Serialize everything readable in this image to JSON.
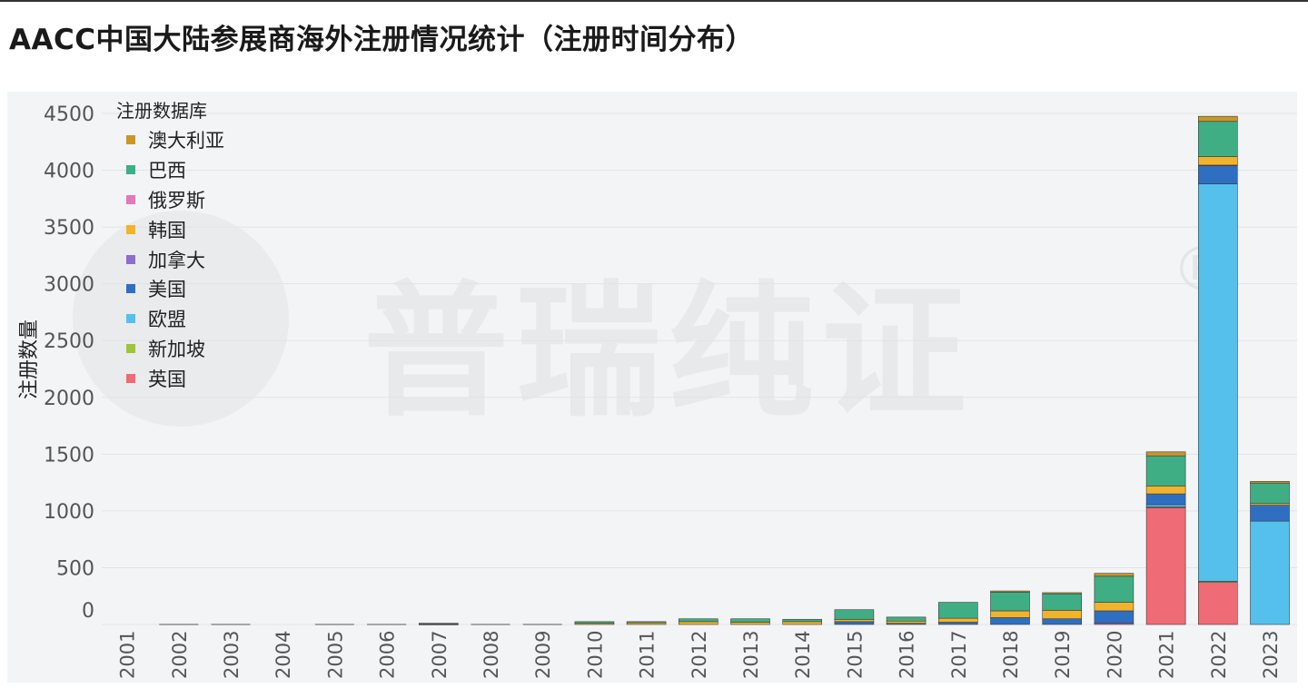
{
  "page": {
    "title": "AACC中国大陆参展商海外注册情况统计（注册时间分布）"
  },
  "watermark": {
    "text": "普瑞纯证",
    "reg_mark": "®"
  },
  "legend": {
    "title": "注册数据库",
    "items": [
      {
        "label": "澳大利亚",
        "color": "#c8962a"
      },
      {
        "label": "巴西",
        "color": "#3fae85"
      },
      {
        "label": "俄罗斯",
        "color": "#e279b8"
      },
      {
        "label": "韩国",
        "color": "#f2b32c"
      },
      {
        "label": "加拿大",
        "color": "#8e6ec8"
      },
      {
        "label": "美国",
        "color": "#2f6fc2"
      },
      {
        "label": "欧盟",
        "color": "#55c0ec"
      },
      {
        "label": "新加坡",
        "color": "#9ec43b"
      },
      {
        "label": "英国",
        "color": "#ef6b76"
      }
    ]
  },
  "chart_data": {
    "type": "bar",
    "stacked": true,
    "ylabel": "注册数量",
    "xlabel": "",
    "ylim": [
      0,
      4500
    ],
    "yticks": [
      0,
      500,
      1000,
      1500,
      2000,
      2500,
      3000,
      3500,
      4000,
      4500
    ],
    "grid": true,
    "legend_position": "top-left",
    "categories": [
      "2001",
      "2002",
      "2003",
      "2004",
      "2005",
      "2006",
      "2007",
      "2008",
      "2009",
      "2010",
      "2011",
      "2012",
      "2013",
      "2014",
      "2015",
      "2016",
      "2017",
      "2018",
      "2019",
      "2020",
      "2021",
      "2022",
      "2023"
    ],
    "series": [
      {
        "name": "英国",
        "color": "#ef6b76",
        "values": [
          0,
          0,
          0,
          0,
          0,
          0,
          0,
          0,
          0,
          0,
          0,
          0,
          0,
          0,
          0,
          0,
          0,
          0,
          0,
          10,
          1030,
          370,
          0
        ]
      },
      {
        "name": "新加坡",
        "color": "#9ec43b",
        "values": [
          0,
          0,
          0,
          0,
          0,
          0,
          0,
          0,
          0,
          0,
          0,
          0,
          0,
          0,
          0,
          0,
          0,
          0,
          0,
          0,
          5,
          10,
          0
        ]
      },
      {
        "name": "欧盟",
        "color": "#55c0ec",
        "values": [
          0,
          0,
          0,
          0,
          0,
          0,
          0,
          0,
          0,
          0,
          0,
          0,
          0,
          0,
          0,
          0,
          0,
          0,
          0,
          0,
          20,
          3500,
          910
        ]
      },
      {
        "name": "美国",
        "color": "#2f6fc2",
        "values": [
          0,
          0,
          0,
          0,
          0,
          0,
          3,
          0,
          0,
          0,
          0,
          0,
          0,
          0,
          25,
          10,
          20,
          60,
          50,
          110,
          95,
          160,
          140
        ]
      },
      {
        "name": "加拿大",
        "color": "#8e6ec8",
        "values": [
          0,
          0,
          0,
          0,
          0,
          0,
          0,
          0,
          0,
          0,
          0,
          0,
          0,
          0,
          0,
          0,
          0,
          0,
          0,
          0,
          0,
          5,
          0
        ]
      },
      {
        "name": "韩国",
        "color": "#f2b32c",
        "values": [
          0,
          0,
          0,
          0,
          0,
          0,
          3,
          0,
          0,
          10,
          15,
          25,
          20,
          25,
          20,
          20,
          35,
          60,
          75,
          75,
          70,
          75,
          15
        ]
      },
      {
        "name": "俄罗斯",
        "color": "#e279b8",
        "values": [
          0,
          0,
          0,
          0,
          0,
          0,
          0,
          0,
          0,
          0,
          0,
          0,
          0,
          0,
          0,
          0,
          0,
          0,
          0,
          0,
          0,
          0,
          0
        ]
      },
      {
        "name": "巴西",
        "color": "#3fae85",
        "values": [
          0,
          0,
          0,
          0,
          0,
          0,
          5,
          0,
          0,
          15,
          10,
          25,
          30,
          20,
          85,
          35,
          140,
          165,
          145,
          230,
          265,
          310,
          180
        ]
      },
      {
        "name": "澳大利亚",
        "color": "#c8962a",
        "values": [
          0,
          0,
          0,
          0,
          0,
          0,
          0,
          0,
          0,
          0,
          0,
          0,
          0,
          0,
          0,
          0,
          0,
          10,
          10,
          25,
          35,
          45,
          15
        ]
      }
    ]
  }
}
